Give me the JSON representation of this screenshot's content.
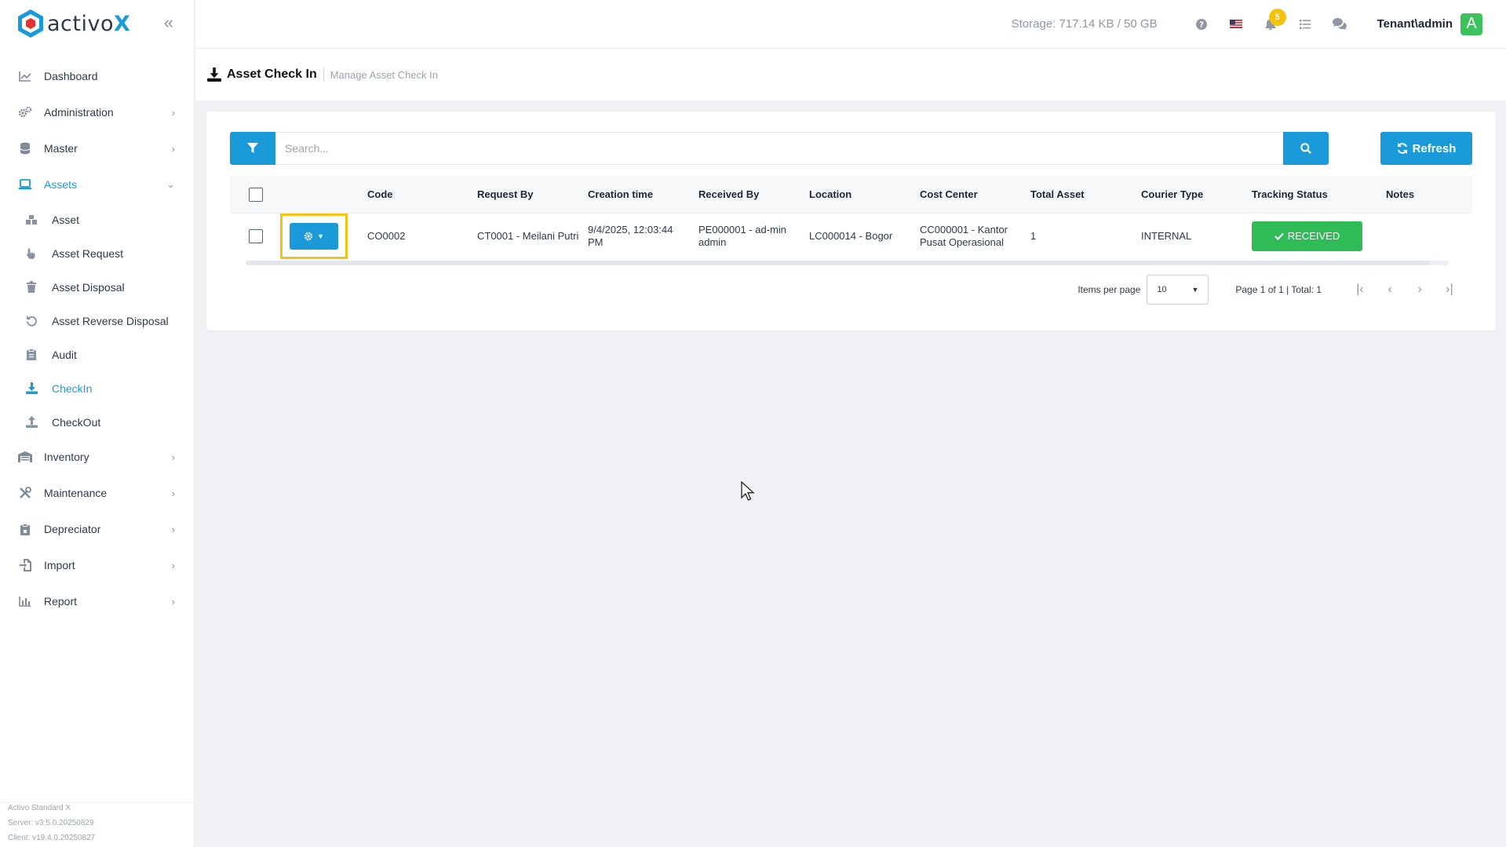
{
  "brand": {
    "name_prefix": "activo",
    "name_suffix": "X",
    "accent": "#1a9ad8"
  },
  "sidebar": {
    "items": [
      {
        "label": "Dashboard",
        "icon": "chart-line-icon"
      },
      {
        "label": "Administration",
        "icon": "gears-icon"
      },
      {
        "label": "Master",
        "icon": "database-icon"
      },
      {
        "label": "Assets",
        "icon": "laptop-icon"
      },
      {
        "label": "Inventory",
        "icon": "warehouse-icon"
      },
      {
        "label": "Maintenance",
        "icon": "tools-icon"
      },
      {
        "label": "Depreciator",
        "icon": "clipboard-icon"
      },
      {
        "label": "Import",
        "icon": "file-import-icon"
      },
      {
        "label": "Report",
        "icon": "chart-bar-icon"
      }
    ],
    "assets_sub": [
      {
        "label": "Asset",
        "icon": "cubes-icon"
      },
      {
        "label": "Asset Request",
        "icon": "hand-pointer-icon"
      },
      {
        "label": "Asset Disposal",
        "icon": "trash-icon"
      },
      {
        "label": "Asset Reverse Disposal",
        "icon": "undo-icon"
      },
      {
        "label": "Audit",
        "icon": "clipboard-list-icon"
      },
      {
        "label": "CheckIn",
        "icon": "download-icon"
      },
      {
        "label": "CheckOut",
        "icon": "upload-icon"
      }
    ],
    "version": {
      "product": "Activo Standard X",
      "server": "Server: v3.5.0.20250829",
      "client": "Client: v19.4.0.20250827"
    }
  },
  "header": {
    "storage": "Storage: 717.14 KB / 50 GB",
    "notification_count": "5",
    "user": "Tenant\\admin",
    "avatar_letter": "A",
    "avatar_color": "#3cc25d"
  },
  "page": {
    "title": "Asset Check In",
    "subtitle": "Manage Asset Check In"
  },
  "search": {
    "placeholder": "Search...",
    "refresh_label": "Refresh"
  },
  "table": {
    "columns": [
      "Code",
      "Request By",
      "Creation time",
      "Received By",
      "Location",
      "Cost Center",
      "Total Asset",
      "Courier Type",
      "Tracking Status",
      "Notes"
    ],
    "rows": [
      {
        "code": "CO0002",
        "request_by": "CT0001 - Meilani Putri",
        "creation_time": "9/4/2025, 12:03:44 PM",
        "received_by": "PE000001 - ad-min admin",
        "location": "LC000014 - Bogor",
        "cost_center": "CC000001 - Kantor Pusat Operasional",
        "total_asset": "1",
        "courier_type": "INTERNAL",
        "tracking_status": "RECEIVED",
        "notes": ""
      }
    ]
  },
  "pager": {
    "items_per_page_label": "Items per page",
    "items_per_page": "10",
    "page_info": "Page 1 of 1 | Total: 1"
  },
  "colors": {
    "primary": "#1a9ad8",
    "success": "#2fbb55",
    "highlight": "#f5c21b",
    "badge": "#f4c20d"
  }
}
